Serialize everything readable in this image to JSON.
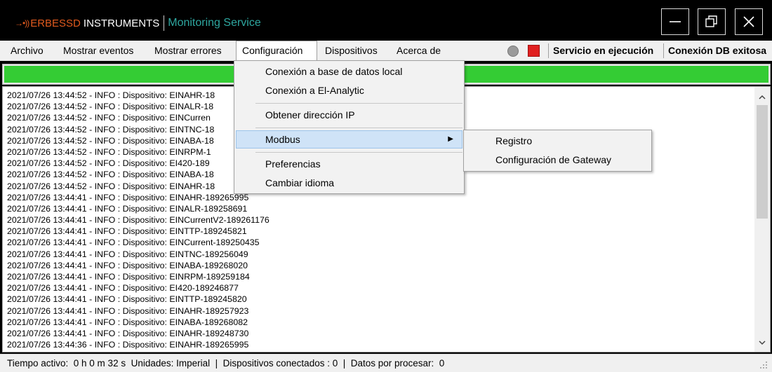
{
  "title_bar": {
    "brand_glyph": "→•))",
    "brand_name_a": "ERBESSD",
    "brand_name_b": "INSTRUMENTS",
    "service_name": "Monitoring Service",
    "brand_color": "#e05a1e",
    "service_color": "#2ea7a0"
  },
  "window_controls": {
    "minimize_icon": "minimize-icon",
    "restore_icon": "restore-icon",
    "close_icon": "close-icon"
  },
  "menu": {
    "items": [
      {
        "label": "Archivo"
      },
      {
        "label": "Mostrar eventos"
      },
      {
        "label": "Mostrar errores"
      },
      {
        "label": "Configuración",
        "active": true
      },
      {
        "label": "Dispositivos"
      },
      {
        "label": "Acerca de"
      }
    ],
    "service_status": "Servicio en ejecución",
    "db_status": "Conexión DB exitosa",
    "status_red": "#e02020",
    "status_green": "#34cc34"
  },
  "progress": {
    "level": 1.0
  },
  "dropdown": {
    "items": [
      {
        "label": "Conexión a base de datos local"
      },
      {
        "label": "Conexión a El-Analytic"
      },
      {
        "label": "Obtener dirección IP"
      },
      {
        "label": "Modbus",
        "has_submenu": true,
        "hover": true
      },
      {
        "label": "Preferencias"
      },
      {
        "label": "Cambiar idioma"
      }
    ],
    "arrow": "▶"
  },
  "submenu": {
    "items": [
      {
        "label": "Registro"
      },
      {
        "label": "Configuración de Gateway"
      }
    ]
  },
  "log": {
    "lines": [
      "2021/07/26 13:44:52 - INFO : Dispositivo: EINAHR-18",
      "2021/07/26 13:44:52 - INFO : Dispositivo: EINALR-18",
      "2021/07/26 13:44:52 - INFO : Dispositivo: EINCurren",
      "2021/07/26 13:44:52 - INFO : Dispositivo: EINTNC-18",
      "2021/07/26 13:44:52 - INFO : Dispositivo: EINABA-18",
      "2021/07/26 13:44:52 - INFO : Dispositivo: EINRPM-1",
      "2021/07/26 13:44:52 - INFO : Dispositivo: EI420-189",
      "2021/07/26 13:44:52 - INFO : Dispositivo: EINABA-18",
      "2021/07/26 13:44:52 - INFO : Dispositivo: EINAHR-18",
      "2021/07/26 13:44:41 - INFO : Dispositivo: EINAHR-189265995",
      "2021/07/26 13:44:41 - INFO : Dispositivo: EINALR-189258691",
      "2021/07/26 13:44:41 - INFO : Dispositivo: EINCurrentV2-189261176",
      "2021/07/26 13:44:41 - INFO : Dispositivo: EINTTP-189245821",
      "2021/07/26 13:44:41 - INFO : Dispositivo: EINCurrent-189250435",
      "2021/07/26 13:44:41 - INFO : Dispositivo: EINTNC-189256049",
      "2021/07/26 13:44:41 - INFO : Dispositivo: EINABA-189268020",
      "2021/07/26 13:44:41 - INFO : Dispositivo: EINRPM-189259184",
      "2021/07/26 13:44:41 - INFO : Dispositivo: EI420-189246877",
      "2021/07/26 13:44:41 - INFO : Dispositivo: EINTTP-189245820",
      "2021/07/26 13:44:41 - INFO : Dispositivo: EINAHR-189257923",
      "2021/07/26 13:44:41 - INFO : Dispositivo: EINABA-189268082",
      "2021/07/26 13:44:41 - INFO : Dispositivo: EINAHR-189248730",
      "2021/07/26 13:44:36 - INFO : Dispositivo: EINAHR-189265995"
    ]
  },
  "status_bar": {
    "text": "Tiempo activo:  0 h 0 m 32 s  Unidades: Imperial  |  Dispositivos conectados : 0  |  Datos por procesar:  0"
  }
}
